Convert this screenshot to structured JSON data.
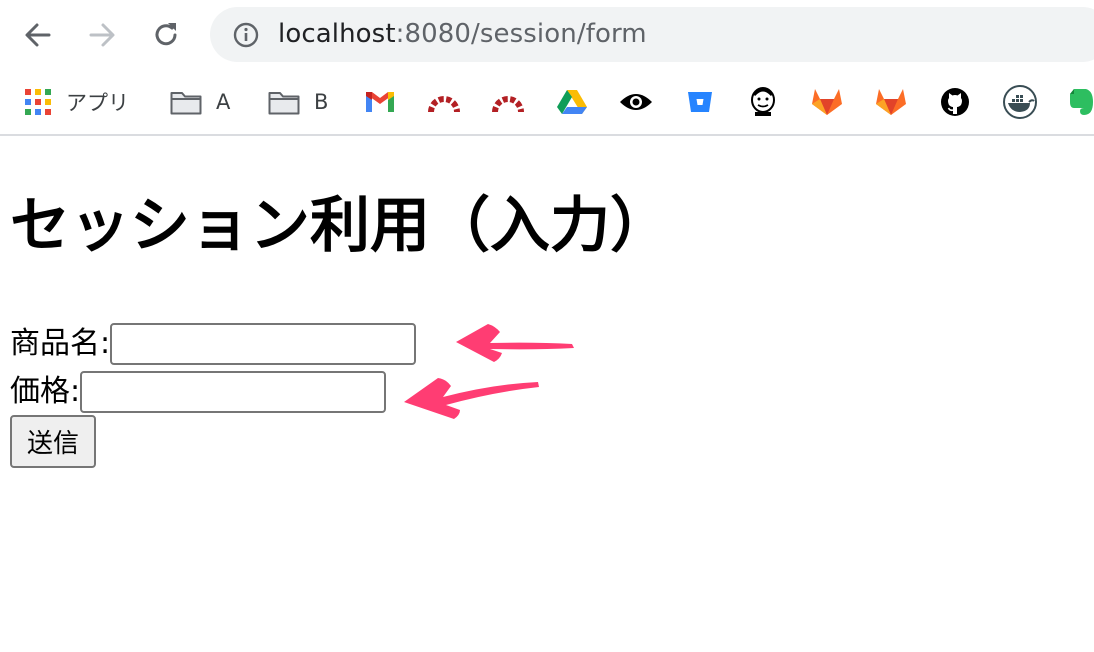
{
  "browser": {
    "url_host": "localhost",
    "url_path": ":8080/session/form",
    "bookmarks": [
      {
        "icon": "apps-grid-icon",
        "label": "アプリ"
      },
      {
        "icon": "folder-icon",
        "label": "A"
      },
      {
        "icon": "folder-icon",
        "label": "B"
      },
      {
        "icon": "gmail-icon",
        "label": ""
      },
      {
        "icon": "redmine-icon",
        "label": ""
      },
      {
        "icon": "redmine-icon",
        "label": ""
      },
      {
        "icon": "google-drive-icon",
        "label": ""
      },
      {
        "icon": "eye-icon",
        "label": ""
      },
      {
        "icon": "bitbucket-icon",
        "label": ""
      },
      {
        "icon": "jenkins-icon",
        "label": ""
      },
      {
        "icon": "gitlab-icon",
        "label": ""
      },
      {
        "icon": "gitlab-icon",
        "label": ""
      },
      {
        "icon": "github-icon",
        "label": ""
      },
      {
        "icon": "docker-icon",
        "label": ""
      },
      {
        "icon": "evernote-icon",
        "label": ""
      }
    ]
  },
  "page": {
    "title": "セッション利用（入力）",
    "form": {
      "product_label": "商品名:",
      "product_value": "",
      "price_label": "価格:",
      "price_value": "",
      "submit_label": "送信"
    }
  },
  "colors": {
    "annotation_arrow": "#ff3d73",
    "omnibox_bg": "#f1f3f4"
  }
}
